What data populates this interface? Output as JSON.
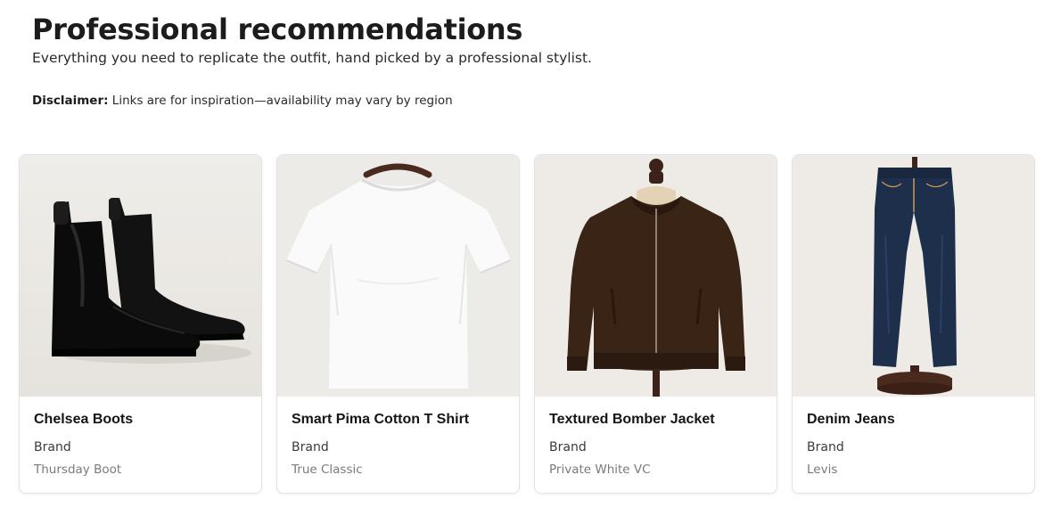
{
  "header": {
    "title": "Professional recommendations",
    "subtitle": "Everything you need to replicate the outfit, hand picked by a professional stylist.",
    "disclaimer_label": "Disclaimer:",
    "disclaimer_text": " Links are for inspiration—availability may vary by region"
  },
  "products": [
    {
      "name": "Chelsea Boots",
      "brand_label": "Brand",
      "brand": "Thursday Boot",
      "image_icon": "chelsea-boots-image"
    },
    {
      "name": "Smart Pima Cotton T Shirt",
      "brand_label": "Brand",
      "brand": "True Classic",
      "image_icon": "white-tshirt-image"
    },
    {
      "name": "Textured Bomber Jacket",
      "brand_label": "Brand",
      "brand": "Private White VC",
      "image_icon": "bomber-jacket-image"
    },
    {
      "name": "Denim Jeans",
      "brand_label": "Brand",
      "brand": "Levis",
      "image_icon": "denim-jeans-image"
    }
  ]
}
